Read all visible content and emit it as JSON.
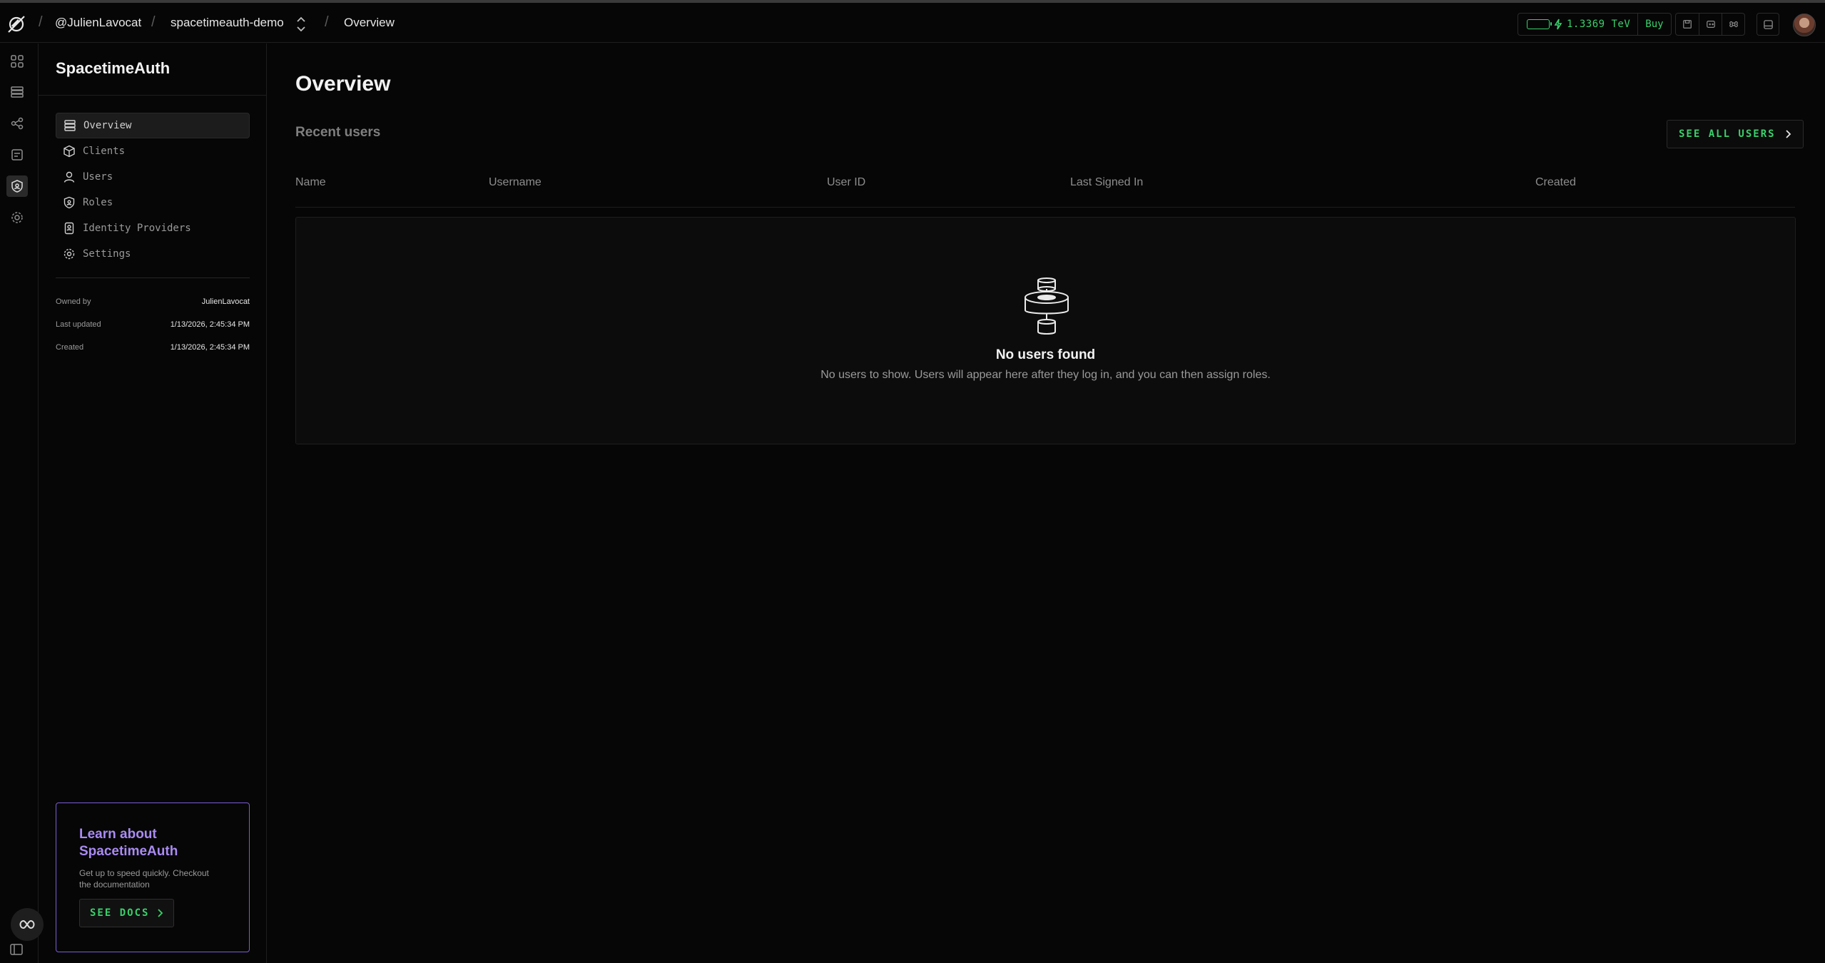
{
  "breadcrumb": {
    "owner": "@JulienLavocat",
    "project": "spacetimeauth-demo",
    "page": "Overview",
    "separator": "/"
  },
  "energy": {
    "value": "1.3369 TeV",
    "buy_label": "Buy",
    "battery_level": 1.0,
    "color": "#3ad06b"
  },
  "rail": {
    "icons": [
      "grid-icon",
      "database-icon",
      "nodes-icon",
      "logs-icon",
      "auth-shield-icon",
      "settings-icon"
    ],
    "active": "auth-shield-icon"
  },
  "sidebar": {
    "title": "SpacetimeAuth",
    "items": [
      {
        "label": "Overview",
        "icon": "stack-icon",
        "active": true
      },
      {
        "label": "Clients",
        "icon": "cube-icon",
        "active": false
      },
      {
        "label": "Users",
        "icon": "user-icon",
        "active": false
      },
      {
        "label": "Roles",
        "icon": "shield-user-icon",
        "active": false
      },
      {
        "label": "Identity Providers",
        "icon": "id-card-icon",
        "active": false
      },
      {
        "label": "Settings",
        "icon": "gear-icon",
        "active": false
      }
    ],
    "meta": {
      "owned_by_label": "Owned by",
      "owned_by": "JulienLavocat",
      "updated_label": "Last updated",
      "updated": "1/13/2026, 2:45:34 PM",
      "created_label": "Created",
      "created": "1/13/2026, 2:45:34 PM"
    },
    "learn": {
      "title": "Learn about SpacetimeAuth",
      "description": "Get up to speed quickly. Checkout the documentation",
      "button": "SEE DOCS",
      "accent": "#7b5cd6"
    }
  },
  "main": {
    "title": "Overview",
    "section_title": "Recent users",
    "see_all": "SEE ALL USERS",
    "columns": [
      "Name",
      "Username",
      "User ID",
      "Last Signed In",
      "Created"
    ],
    "empty": {
      "title": "No users found",
      "message": "No users to show. Users will appear here after they log in, and you can then assign roles."
    }
  }
}
